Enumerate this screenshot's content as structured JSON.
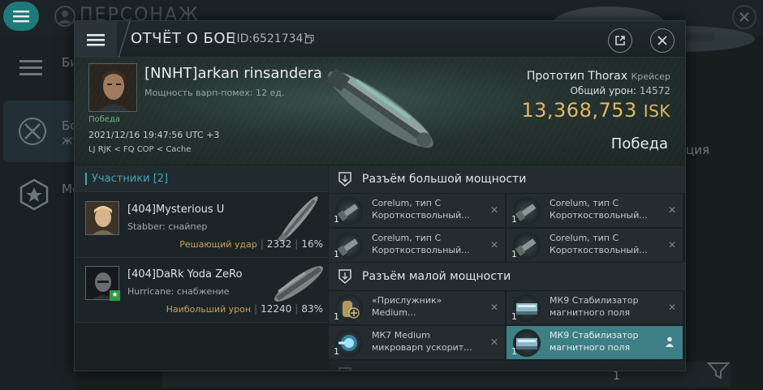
{
  "background": {
    "title": "ПЕРСОНАЖ",
    "sidebar_items": [
      {
        "label": "Би",
        "icon": "list-icon"
      },
      {
        "label": "Бо\nжу",
        "icon": "crossed-swords-icon"
      },
      {
        "label": "Ме",
        "icon": "star-hexagon-icon"
      }
    ],
    "right_text": "ция",
    "bottom_number": "1"
  },
  "header": {
    "title": "ОТЧЁТ О БОЕ",
    "id": "[ID:6521734]"
  },
  "summary": {
    "pilot": "[NNHT]arkan rinsandera",
    "warp": "Мощность варп-помех: 12 ед.",
    "outcome_tag": "Победа",
    "datetime": "2021/12/16 19:47:56 UTC +3",
    "location": "LJ RJK < FQ COP < Cache",
    "ship_name": "Прототип Thorax",
    "ship_class": "Крейсер",
    "total_damage_label": "Общий урон:",
    "total_damage": "14572",
    "isk_value": "13,368,753",
    "isk_unit": "ISK",
    "result": "Победа"
  },
  "participants": {
    "label": "Участники",
    "count": "[2]",
    "items": [
      {
        "name": "[404]Mysterious U",
        "role": "Stabber: снайпер",
        "tag": "Решающий удар",
        "damage": "2332",
        "percent": "16%"
      },
      {
        "name": "[404]DaRk Yoda ZeRo",
        "role": "Hurricane: снабжение",
        "tag": "Наибольший урон",
        "damage": "12240",
        "percent": "83%"
      }
    ]
  },
  "fitting": {
    "high_slots_label": "Разъём большой мощности",
    "low_slots_label": "Разъём малой мощности",
    "high_slots": [
      {
        "qty": "1",
        "name": "Corelum, тип C",
        "sub": "Короткоствольный..."
      },
      {
        "qty": "1",
        "name": "Corelum, тип C",
        "sub": "Короткоствольный..."
      },
      {
        "qty": "1",
        "name": "Corelum, тип C",
        "sub": "Короткоствольный..."
      },
      {
        "qty": "1",
        "name": "Corelum, тип C",
        "sub": "Короткоствольный..."
      }
    ],
    "low_slots": [
      {
        "qty": "1",
        "name": "«Прислужник»",
        "sub": "Medium..."
      },
      {
        "qty": "1",
        "name": "МК9 Стабилизатор",
        "sub": "магнитного поля"
      },
      {
        "qty": "1",
        "name": "МК7 Medium",
        "sub": "микроварп ускорит..."
      },
      {
        "qty": "1",
        "name": "МК9 Стабилизатор",
        "sub": "магнитного поля"
      }
    ]
  },
  "colors": {
    "accent": "#1e7a78",
    "isk": "#e3b763",
    "highlight": "#3d7f85",
    "participants_accent": "#3fa7b5"
  }
}
